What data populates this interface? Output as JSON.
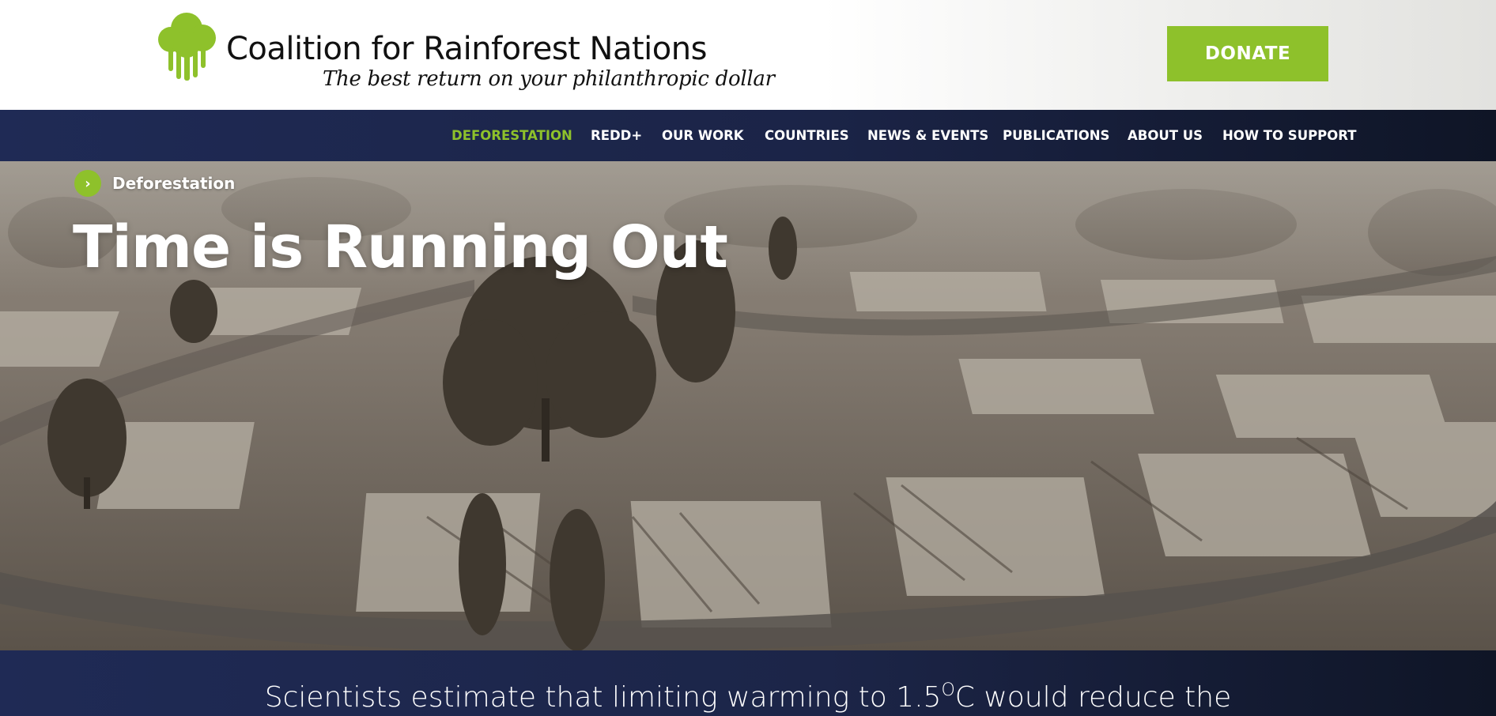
{
  "header": {
    "logo_title": "Coalition for Rainforest Nations",
    "logo_tagline": "The best return on your philanthropic dollar",
    "donate_label": "DONATE",
    "logo_icon": "tree-icon",
    "brand_color": "#8ec12b"
  },
  "nav": {
    "items": [
      {
        "label": "DEFORESTATION",
        "active": true
      },
      {
        "label": "REDD+"
      },
      {
        "label": "OUR WORK"
      },
      {
        "label": "COUNTRIES"
      },
      {
        "label": "NEWS & EVENTS"
      },
      {
        "label": "PUBLICATIONS"
      },
      {
        "label": "ABOUT US"
      },
      {
        "label": "HOW TO SUPPORT"
      }
    ],
    "background": "#1b2447"
  },
  "hero": {
    "breadcrumb_label": "Deforestation",
    "breadcrumb_icon": "chevron-right-icon",
    "title": "Time is Running Out",
    "image": "burned-neighborhood-aerial-photo"
  },
  "intro": {
    "text_before": "Scientists estimate that limiting warming to 1.5",
    "superscript": "O",
    "text_after": "C would reduce the"
  }
}
